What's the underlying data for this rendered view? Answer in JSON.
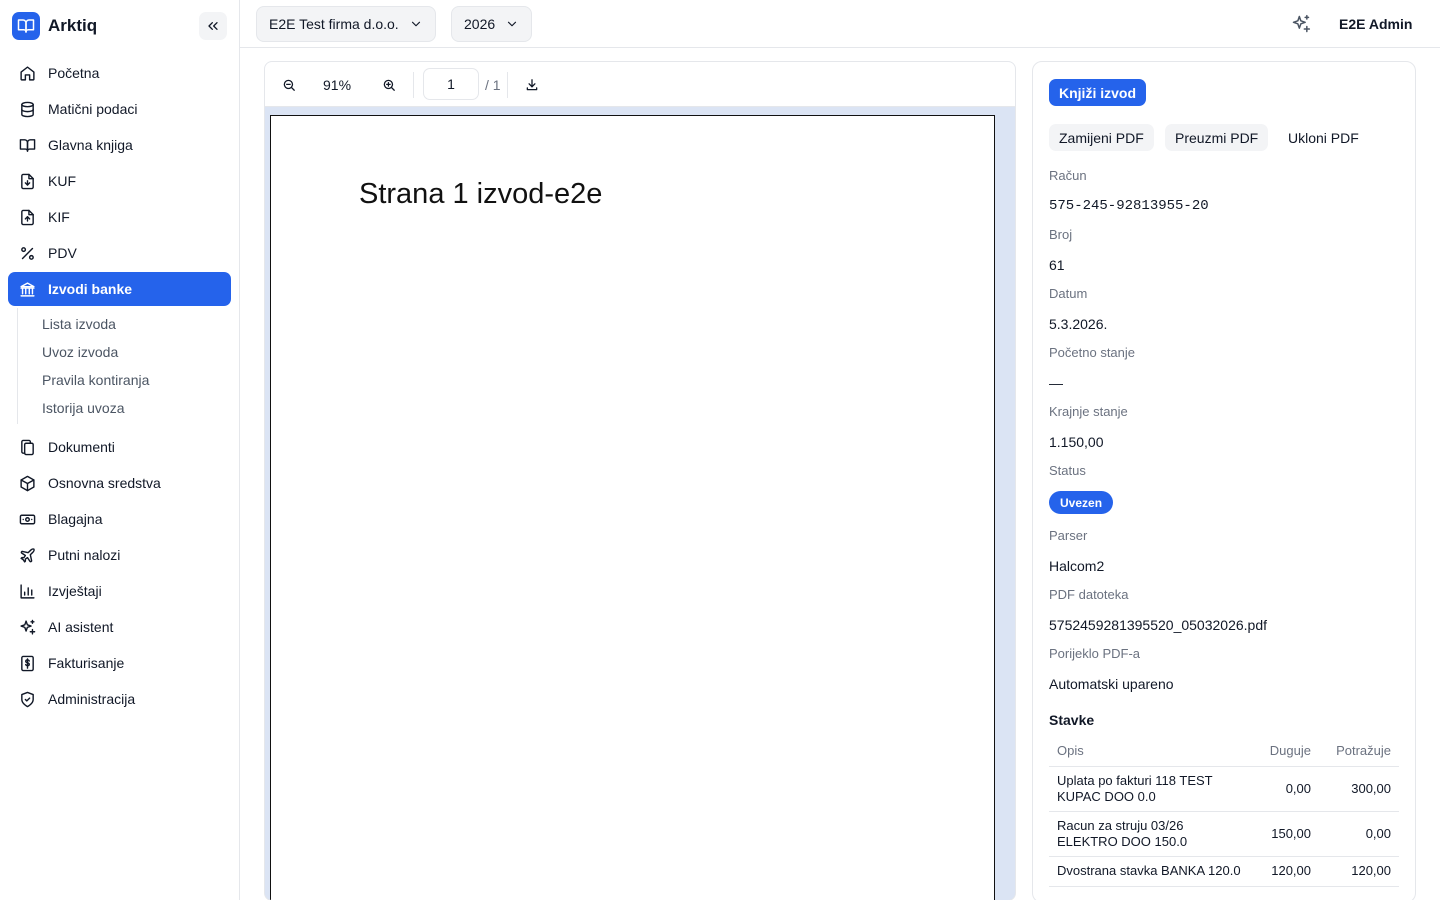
{
  "app": {
    "name": "Arktiq"
  },
  "sidebar": {
    "items": [
      {
        "label": "Početna",
        "icon": "home-icon"
      },
      {
        "label": "Matični podaci",
        "icon": "database-icon"
      },
      {
        "label": "Glavna knjiga",
        "icon": "book-icon"
      },
      {
        "label": "KUF",
        "icon": "file-down-icon"
      },
      {
        "label": "KIF",
        "icon": "file-up-icon"
      },
      {
        "label": "PDV",
        "icon": "percent-icon"
      },
      {
        "label": "Izvodi banke",
        "icon": "bank-icon",
        "active": true
      },
      {
        "label": "Dokumenti",
        "icon": "documents-icon"
      },
      {
        "label": "Osnovna sredstva",
        "icon": "package-icon"
      },
      {
        "label": "Blagajna",
        "icon": "cash-icon"
      },
      {
        "label": "Putni nalozi",
        "icon": "plane-icon"
      },
      {
        "label": "Izvještaji",
        "icon": "bar-chart-icon"
      },
      {
        "label": "AI asistent",
        "icon": "sparkle-icon"
      },
      {
        "label": "Fakturisanje",
        "icon": "invoice-dollar-icon"
      },
      {
        "label": "Administracija",
        "icon": "shield-icon"
      }
    ],
    "subitems": [
      "Lista izvoda",
      "Uvoz izvoda",
      "Pravila kontiranja",
      "Istorija uvoza"
    ]
  },
  "topbar": {
    "company": "E2E Test firma d.o.o.",
    "year": "2026",
    "user": "E2E Admin"
  },
  "viewer": {
    "zoom": "91%",
    "page_current": "1",
    "page_total": "/ 1",
    "page_text": "Strana 1 izvod-e2e"
  },
  "panel": {
    "post_button": "Knjiži izvod",
    "replace_pdf": "Zamijeni PDF",
    "download_pdf": "Preuzmi PDF",
    "remove_pdf": "Ukloni PDF",
    "fields": {
      "account_label": "Račun",
      "account_value": "575-245-92813955-20",
      "number_label": "Broj",
      "number_value": "61",
      "date_label": "Datum",
      "date_value": "5.3.2026.",
      "opening_label": "Početno stanje",
      "opening_value": "—",
      "closing_label": "Krajnje stanje",
      "closing_value": "1.150,00",
      "status_label": "Status",
      "status_value": "Uvezen",
      "parser_label": "Parser",
      "parser_value": "Halcom2",
      "pdf_label": "PDF datoteka",
      "pdf_value": "5752459281395520_05032026.pdf",
      "origin_label": "Porijeklo PDF-a",
      "origin_value": "Automatski upareno"
    },
    "lines_title": "Stavke",
    "lines_headers": {
      "desc": "Opis",
      "debit": "Duguje",
      "credit": "Potražuje"
    },
    "lines": [
      {
        "desc": "Uplata po fakturi 118 TEST KUPAC DOO 0.0",
        "debit": "0,00",
        "credit": "300,00"
      },
      {
        "desc": "Racun za struju 03/26 ELEKTRO DOO 150.0",
        "debit": "150,00",
        "credit": "0,00"
      },
      {
        "desc": "Dvostrana stavka BANKA 120.0",
        "debit": "120,00",
        "credit": "120,00"
      }
    ]
  },
  "colors": {
    "accent": "#2563eb",
    "border": "#e5e7eb",
    "muted": "#6b7280",
    "pdf_bg": "#dbe4f4"
  }
}
